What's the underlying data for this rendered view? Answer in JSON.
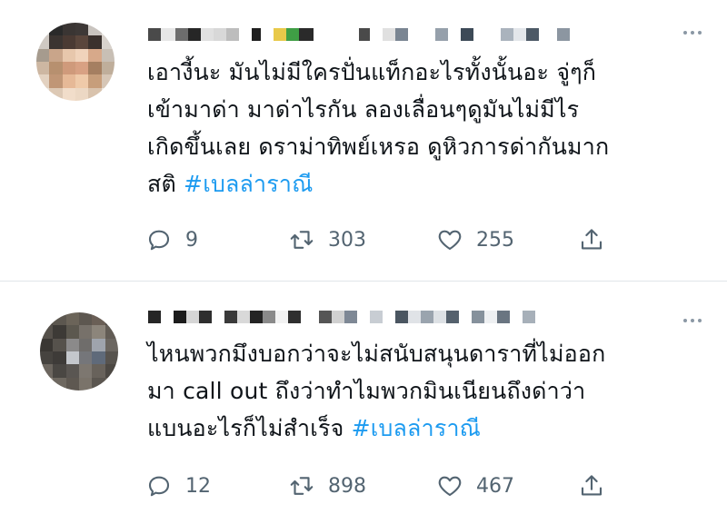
{
  "tweets": [
    {
      "text_main": "เอางี้นะ มันไม่มีใครปั่นแท็กอะไรทั้งนั้นอะ จู่ๆก็\nเข้ามาด่า มาด่าไรกัน ลองเลื่อนๆดูมันไม่มีไร\nเกิดขึ้นเลย ดราม่าทิพย์เหรอ ดูหิวการด่ากันมาก\nสติ ",
      "hashtag": "#เบลล่าราณี",
      "replies": "9",
      "retweets": "303",
      "likes": "255"
    },
    {
      "text_main": "ไหนพวกมึงบอกว่าจะไม่สนับสนุนดาราที่ไม่ออก\nมา call out ถึงว่าทำไมพวกมินเนียนถึงด่าว่า\nแบนอะไรก็ไม่สำเร็จ ",
      "hashtag": "#เบลล่าราณี",
      "replies": "12",
      "retweets": "898",
      "likes": "467"
    }
  ],
  "icons": {
    "reply": "reply-icon",
    "retweet": "retweet-icon",
    "like": "heart-icon",
    "share": "share-icon",
    "more": "more-icon"
  },
  "colors": {
    "hashtag": "#1d9bf0",
    "action_gray": "#536471",
    "divider": "#e1e6ea"
  }
}
